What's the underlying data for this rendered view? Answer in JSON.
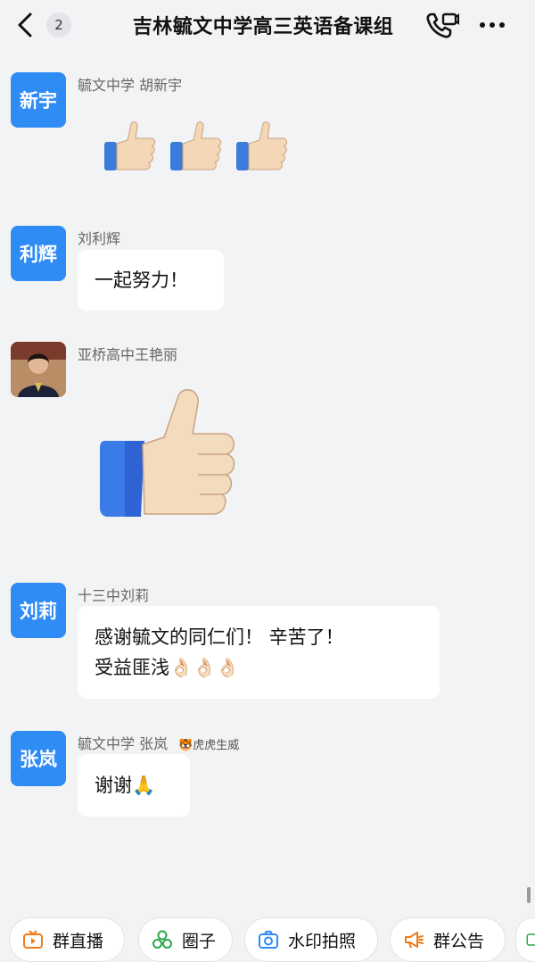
{
  "header": {
    "back_badge": "2",
    "title": "吉林毓文中学高三英语备课组"
  },
  "messages": [
    {
      "sender": "毓文中学 胡新宇",
      "avatar_text": "新宇",
      "content": "👍👍👍"
    },
    {
      "sender": "刘利辉",
      "avatar_text": "利辉",
      "content": "一起努力！"
    },
    {
      "sender": "亚桥高中王艳丽",
      "content": "👍"
    },
    {
      "sender": "十三中刘莉",
      "avatar_text": "刘莉",
      "lines": [
        "感谢毓文的同仁们！ 辛苦了！",
        "受益匪浅👌🏻👌🏻👌🏻"
      ]
    },
    {
      "sender": "毓文中学 张岚",
      "avatar_text": "张岚",
      "tag": "🐯虎虎生威",
      "content": "谢谢🙏"
    }
  ],
  "toolbar": [
    {
      "label": "群直播",
      "icon": "live-tv-icon"
    },
    {
      "label": "圈子",
      "icon": "circles-icon"
    },
    {
      "label": "水印拍照",
      "icon": "camera-icon"
    },
    {
      "label": "群公告",
      "icon": "megaphone-icon"
    }
  ],
  "colors": {
    "accent": "#2f8cf5",
    "background": "#f2f3f5",
    "bubble": "#ffffff"
  }
}
